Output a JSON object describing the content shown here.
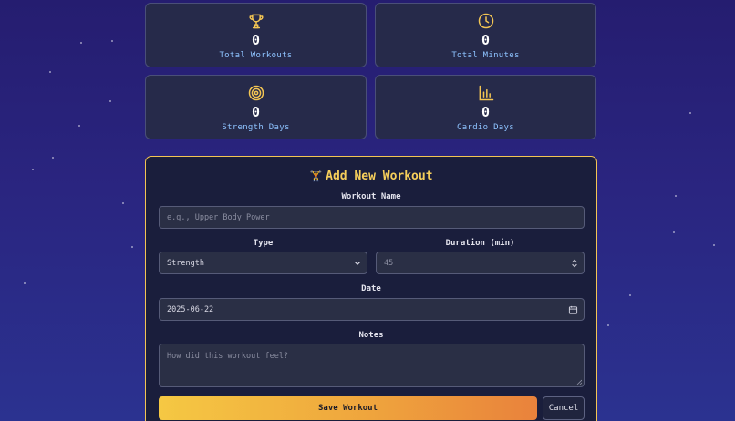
{
  "stats": [
    {
      "icon": "trophy-icon",
      "value": "0",
      "label": "Total Workouts"
    },
    {
      "icon": "clock-icon",
      "value": "0",
      "label": "Total Minutes"
    },
    {
      "icon": "target-icon",
      "value": "0",
      "label": "Strength Days"
    },
    {
      "icon": "bar-chart-icon",
      "value": "0",
      "label": "Cardio Days"
    }
  ],
  "form": {
    "title_emoji": "🏋",
    "title": "Add New Workout",
    "name_label": "Workout Name",
    "name_placeholder": "e.g., Upper Body Power",
    "type_label": "Type",
    "type_value": "Strength",
    "duration_label": "Duration (min)",
    "duration_placeholder": "45",
    "date_label": "Date",
    "date_value": "2025-06-22",
    "notes_label": "Notes",
    "notes_placeholder": "How did this workout feel?",
    "save_label": "Save Workout",
    "cancel_label": "Cancel"
  },
  "colors": {
    "accent": "#f3c553",
    "stat_label": "#8ec3ff",
    "background": "#2a2580"
  }
}
